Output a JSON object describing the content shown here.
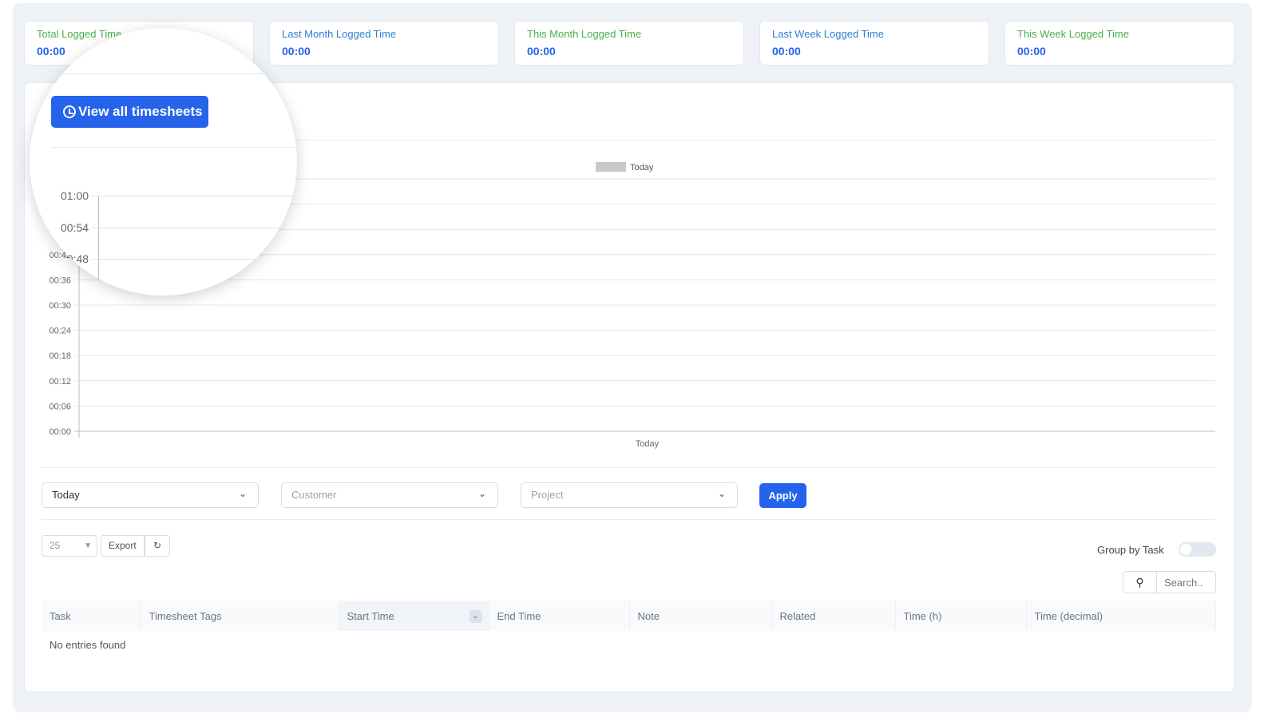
{
  "stats": [
    {
      "label": "Total Logged Time",
      "value": "00:00"
    },
    {
      "label": "Last Month Logged Time",
      "value": "00:00"
    },
    {
      "label": "This Month Logged Time",
      "value": "00:00"
    },
    {
      "label": "Last Week Logged Time",
      "value": "00:00"
    },
    {
      "label": "This Week Logged Time",
      "value": "00:00"
    }
  ],
  "view_all_label": "View all timesheets",
  "chart_data": {
    "type": "bar",
    "categories": [
      "Today"
    ],
    "series": [
      {
        "name": "Today",
        "values": [
          0
        ],
        "color": "#c8c8c8"
      }
    ],
    "yticks": [
      "00:00",
      "00:06",
      "00:12",
      "00:18",
      "00:24",
      "00:30",
      "00:36",
      "00:42",
      "00:48",
      "00:54",
      "01:00"
    ],
    "ylim": [
      0,
      60
    ],
    "grid": true,
    "legend": "top"
  },
  "filters": {
    "period": "Today",
    "customer_placeholder": "Customer",
    "project_placeholder": "Project",
    "apply": "Apply"
  },
  "table_controls": {
    "page_size": "25",
    "export": "Export",
    "group_by_task": "Group by Task",
    "group_by_task_on": false,
    "search_placeholder": "Search.."
  },
  "table": {
    "columns": [
      "Task",
      "Timesheet Tags",
      "Start Time",
      "End Time",
      "Note",
      "Related",
      "Time (h)",
      "Time (decimal)"
    ],
    "empty": "No entries found"
  }
}
